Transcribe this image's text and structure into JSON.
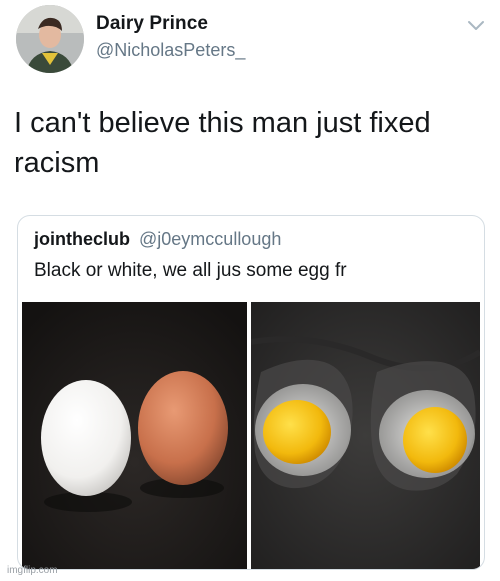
{
  "tweet": {
    "display_name": "Dairy Prince",
    "handle": "@NicholasPeters_",
    "text_line1": "I can't believe this man just fixed",
    "text_line2": "racism"
  },
  "quoted_tweet": {
    "display_name": "jointheclub",
    "handle": "@j0eymccullough",
    "text": "Black or white, we all jus some egg fr"
  },
  "icons": {
    "avatar": "avatar",
    "menu": "chevron-down-icon"
  },
  "watermark": "imgflip.com",
  "colors": {
    "text": "#14171a",
    "secondary_text": "#657786",
    "border": "#d5dde3"
  }
}
